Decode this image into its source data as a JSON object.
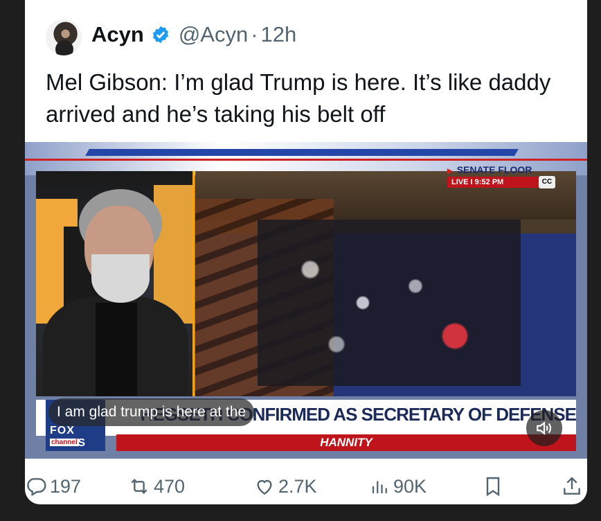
{
  "tweet": {
    "author_name": "Acyn",
    "handle": "@Acyn",
    "separator": "·",
    "time": "12h",
    "text": "Mel Gibson: I’m glad Trump is here. It’s like daddy arrived and he’s taking his belt off"
  },
  "video": {
    "senate_label": "SENATE FLOOR",
    "live_label": "LIVE  I  9:52 PM",
    "cc_label": "CC",
    "lower_third": "HEGSETH CONFIRMED AS SECRETARY OF DEFENSE",
    "show_name": "HANNITY",
    "network_logo": "FOX NEWS",
    "network_sub": "channel",
    "caption": "I am glad trump is here at the"
  },
  "actions": {
    "replies": "197",
    "reposts": "470",
    "likes": "2.7K",
    "views": "90K"
  },
  "colors": {
    "verified_blue": "#1d9bf0",
    "text_primary": "#0f1419",
    "text_secondary": "#536471"
  },
  "icons": [
    "verified-badge-icon",
    "reply-icon",
    "repost-icon",
    "like-icon",
    "views-icon",
    "bookmark-icon",
    "share-icon",
    "mute-icon"
  ]
}
